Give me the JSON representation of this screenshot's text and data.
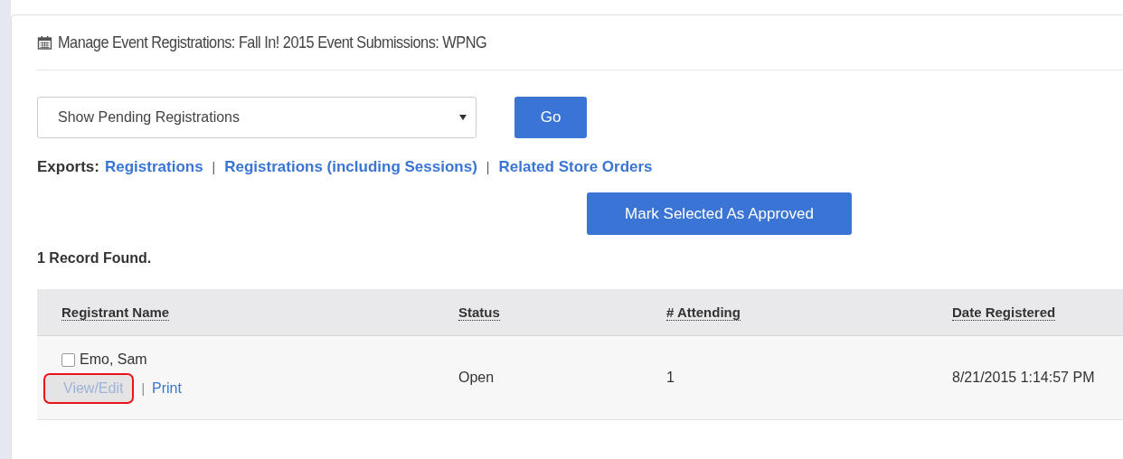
{
  "title": "Manage Event Registrations: Fall In! 2015 Event Submissions: WPNG",
  "filter": {
    "value": "Show Pending Registrations"
  },
  "go_button": "Go",
  "exports": {
    "label": "Exports:",
    "links": [
      "Registrations",
      "Registrations (including Sessions)",
      "Related Store Orders"
    ],
    "separator": "|"
  },
  "approve_button": "Mark Selected As Approved",
  "record_count": "1 Record Found.",
  "table": {
    "columns": [
      "Registrant Name",
      "Status",
      "# Attending",
      "Date Registered"
    ],
    "rows": [
      {
        "checked": false,
        "name": "Emo, Sam",
        "actions": [
          {
            "label": "View/Edit",
            "hovered": true,
            "highlighted": true
          },
          {
            "label": "Print",
            "hovered": false,
            "highlighted": false
          }
        ],
        "separator": "|",
        "status": "Open",
        "attending": "1",
        "date": "8/21/2015 1:14:57 PM"
      }
    ]
  }
}
